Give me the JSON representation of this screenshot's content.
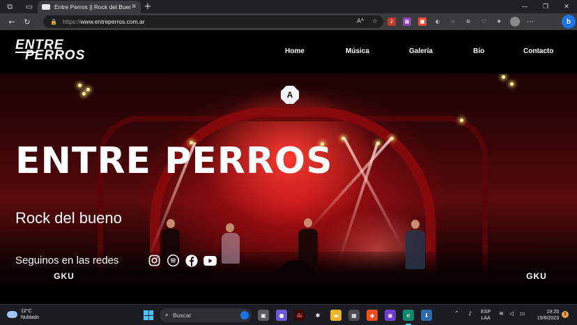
{
  "browser": {
    "tab_title": "Entre Perros || Rock del Bueno",
    "tab_close": "✕",
    "new_tab": "+",
    "url_prefix": "https://",
    "url_host": "www.entreperros.com.ar",
    "read_aloud": "Aᴬ",
    "favorite": "☆",
    "win_min": "—",
    "win_restore": "❐",
    "win_close": "✕"
  },
  "site": {
    "logo_line1": "ENTRE",
    "logo_line2": "PERROS",
    "nav": [
      "Home",
      "Música",
      "Galería",
      "Bío",
      "Contacto"
    ]
  },
  "hero": {
    "title": "ENTRE PERROS",
    "tagline": "Rock del bueno",
    "social_label": "Seguinos en las redes",
    "social_icons": [
      "instagram-icon",
      "spotify-icon",
      "facebook-icon",
      "youtube-icon"
    ],
    "badge_letter": "A",
    "banner_left": "GKU",
    "banner_right": "GKU"
  },
  "taskbar": {
    "temperature": "12°C",
    "weather": "Nublado",
    "search_placeholder": "Buscar",
    "lang_top": "ESP",
    "lang_bottom": "LAA",
    "time": "19:25",
    "date": "19/6/2023",
    "notifications": "1"
  },
  "colors": {
    "accent": "#4cc2ff",
    "stage_red": "#c8101a",
    "page_bg": "#000000"
  }
}
